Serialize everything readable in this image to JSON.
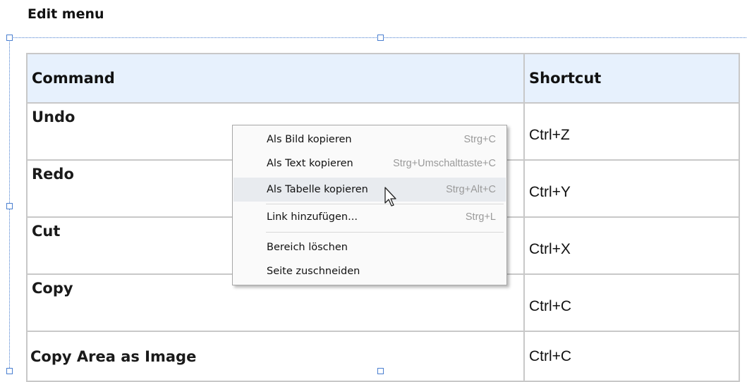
{
  "heading": "Edit menu",
  "table": {
    "headers": [
      "Command",
      "Shortcut"
    ],
    "rows": [
      {
        "command": "Undo",
        "shortcut": "Ctrl+Z"
      },
      {
        "command": "Redo",
        "shortcut": "Ctrl+Y"
      },
      {
        "command": "Cut",
        "shortcut": "Ctrl+X"
      },
      {
        "command": "Copy",
        "shortcut": "Ctrl+C"
      },
      {
        "command": "Copy Area as Image",
        "shortcut": "Ctrl+C"
      }
    ]
  },
  "context_menu": {
    "items": [
      {
        "label": "Als Bild kopieren",
        "shortcut": "Strg+C"
      },
      {
        "label": "Als Text kopieren",
        "shortcut": "Strg+Umschalttaste+C"
      },
      {
        "label": "Als Tabelle kopieren",
        "shortcut": "Strg+Alt+C",
        "highlighted": true
      },
      {
        "label": "Link hinzufügen...",
        "shortcut": "Strg+L"
      },
      {
        "label": "Bereich löschen",
        "shortcut": ""
      },
      {
        "label": "Seite zuschneiden",
        "shortcut": ""
      }
    ]
  },
  "colors": {
    "header_bg": "#e7f1fd",
    "selection": "#4a7fd0",
    "menu_highlight": "#e8ebef"
  },
  "icons": {
    "cursor": "arrow-pointer-icon"
  }
}
